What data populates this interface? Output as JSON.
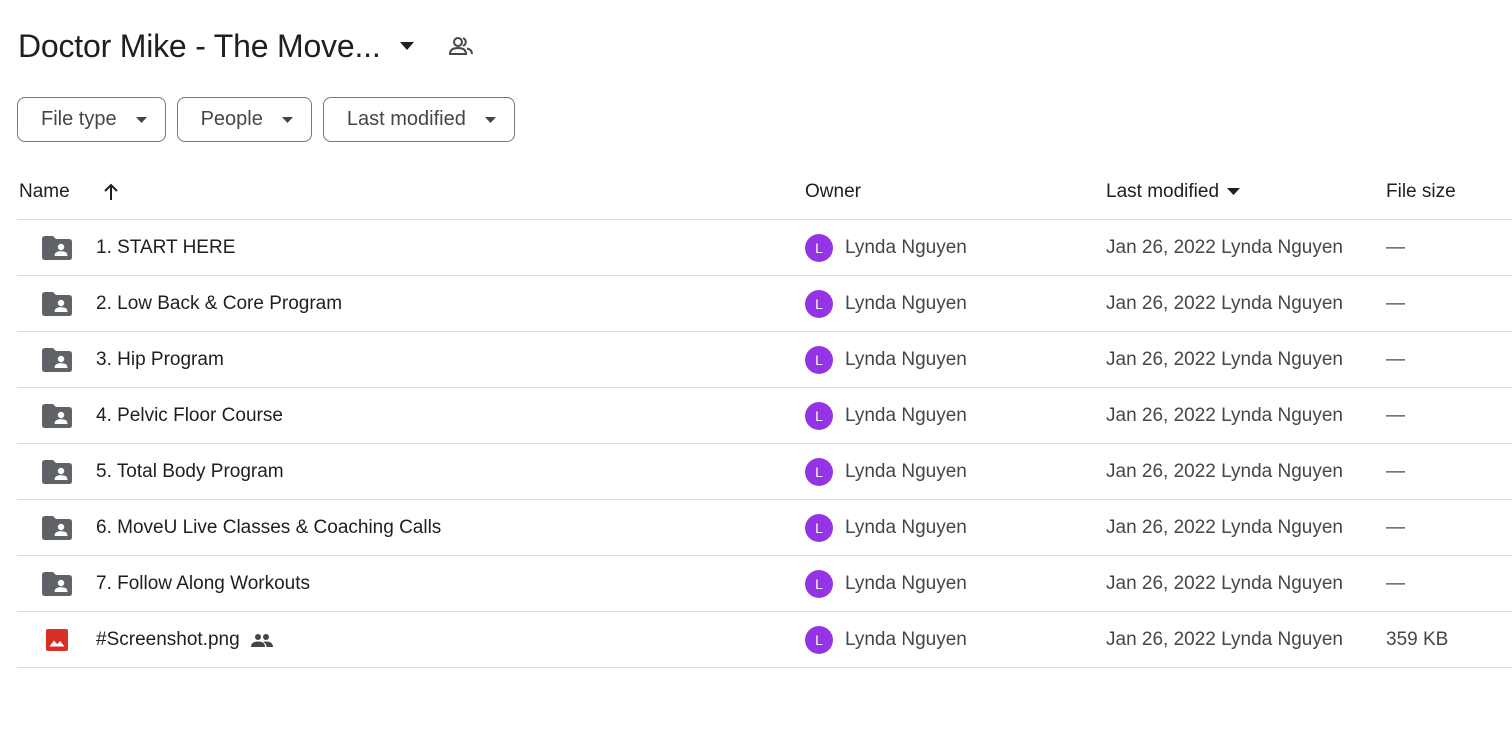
{
  "header": {
    "title": "Doctor Mike - The Move...",
    "title_dropdown_icon": "arrow-drop-down-icon",
    "shared_icon": "people-outline-icon"
  },
  "filters": [
    {
      "label": "File type"
    },
    {
      "label": "People"
    },
    {
      "label": "Last modified"
    }
  ],
  "table": {
    "columns": {
      "name": "Name",
      "owner": "Owner",
      "last_modified": "Last modified",
      "file_size": "File size"
    },
    "sort": {
      "column": "Name",
      "direction": "ascending"
    },
    "rows": [
      {
        "name": "1. START HERE",
        "type": "shared-folder",
        "owner_initial": "L",
        "owner": "Lynda Nguyen",
        "modified": "Jan 26, 2022 Lynda Nguyen",
        "size": "—"
      },
      {
        "name": "2. Low Back & Core Program",
        "type": "shared-folder",
        "owner_initial": "L",
        "owner": "Lynda Nguyen",
        "modified": "Jan 26, 2022 Lynda Nguyen",
        "size": "—"
      },
      {
        "name": "3. Hip Program",
        "type": "shared-folder",
        "owner_initial": "L",
        "owner": "Lynda Nguyen",
        "modified": "Jan 26, 2022 Lynda Nguyen",
        "size": "—"
      },
      {
        "name": "4. Pelvic Floor Course",
        "type": "shared-folder",
        "owner_initial": "L",
        "owner": "Lynda Nguyen",
        "modified": "Jan 26, 2022 Lynda Nguyen",
        "size": "—"
      },
      {
        "name": "5. Total Body Program",
        "type": "shared-folder",
        "owner_initial": "L",
        "owner": "Lynda Nguyen",
        "modified": "Jan 26, 2022 Lynda Nguyen",
        "size": "—"
      },
      {
        "name": "6. MoveU Live Classes & Coaching Calls",
        "type": "shared-folder",
        "owner_initial": "L",
        "owner": "Lynda Nguyen",
        "modified": "Jan 26, 2022 Lynda Nguyen",
        "size": "—"
      },
      {
        "name": "7. Follow Along Workouts",
        "type": "shared-folder",
        "owner_initial": "L",
        "owner": "Lynda Nguyen",
        "modified": "Jan 26, 2022 Lynda Nguyen",
        "size": "—"
      },
      {
        "name": "#Screenshot.png",
        "type": "image",
        "shared": true,
        "owner_initial": "L",
        "owner": "Lynda Nguyen",
        "modified": "Jan 26, 2022 Lynda Nguyen",
        "size": "359 KB"
      }
    ]
  },
  "colors": {
    "avatar": "#9334e6",
    "folder_icon": "#5f6368",
    "image_icon": "#d93025",
    "divider": "#dadce0"
  }
}
